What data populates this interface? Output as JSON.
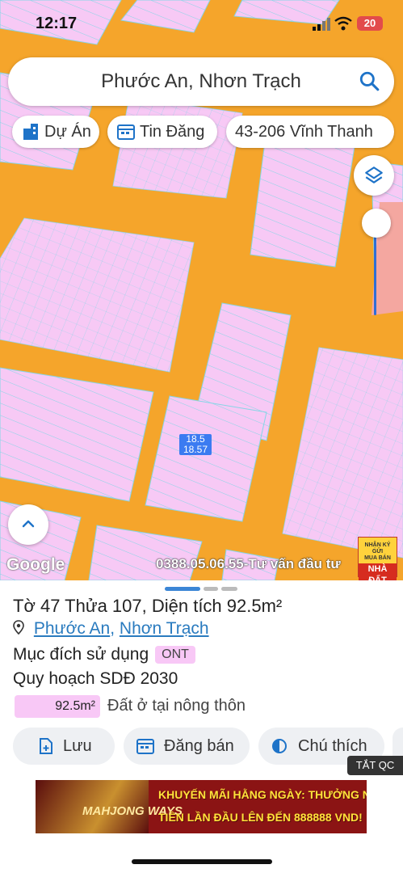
{
  "status_bar": {
    "time": "12:17",
    "battery": "20"
  },
  "search": {
    "query": "Phước An, Nhơn Trạch"
  },
  "chips": [
    {
      "label": "Dự Án",
      "icon": "building-icon"
    },
    {
      "label": "Tin Đăng",
      "icon": "calendar-icon"
    },
    {
      "label": "43-206 Vĩnh Thanh",
      "icon": ""
    }
  ],
  "map": {
    "plot_label_line1": "18.5",
    "plot_label_line2": "18.57",
    "google_logo": "Google",
    "watermark": "0388.05.06.55-Tư vấn đầu tư",
    "badge": {
      "line1": "NHẬN KÝ GỬI",
      "line2": "MUA BÁN",
      "line3": "NHÀ ĐẤT"
    },
    "colors": {
      "road": "#f5a52b",
      "land": "#f7c9f5",
      "grid": "#86d6e6",
      "plot_label": "#3b7bf1"
    }
  },
  "parcel": {
    "title": "Tờ 47 Thửa 107, Diện tích 92.5m²",
    "location_ward": "Phước An",
    "location_sep": ", ",
    "location_district": "Nhơn Trạch",
    "purpose_label": "Mục đích sử dụng",
    "purpose_code": "ONT",
    "plan_label": "Quy hoạch SDĐ 2030",
    "area_value": "92.5m²",
    "area_desc": "Đất ở tại nông thôn"
  },
  "actions": [
    {
      "label": "Lưu",
      "icon": "add-file-icon"
    },
    {
      "label": "Đăng bán",
      "icon": "calendar-icon"
    },
    {
      "label": "Chú thích",
      "icon": "contrast-icon"
    }
  ],
  "ad": {
    "close_label": "TẮT QC",
    "line1": "KHUYẾN MÃI HẰNG NGÀY: THƯỞNG NẠP",
    "line2": "TIỀN LẦN ĐẦU LÊN ĐẾN 888888 VND!",
    "brand": "MAHJONG WAYS"
  }
}
